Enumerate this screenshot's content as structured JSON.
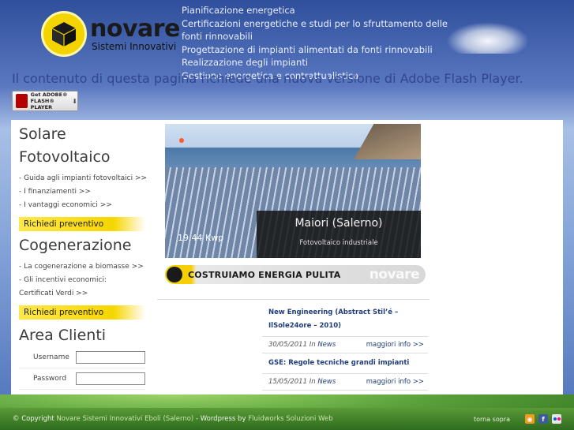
{
  "header": {
    "logo_name": "novare",
    "logo_sub": "Sistemi Innovativi",
    "services": [
      "Pianificazione energetica",
      "Certificazioni energetiche e studi per lo sfruttamento delle fonti rinnovabili",
      "Progettazione di impianti alimentati da fonti rinnovabili",
      "Realizzazione degli impianti",
      "Gestione energetica e contrattualistica"
    ],
    "flash_message": "Il contenuto di questa pagina richiede una nuova versione di Adobe Flash Player.",
    "flash_badge": {
      "line1": "Get ADOBE®",
      "line2": "FLASH® PLAYER"
    }
  },
  "sidebar": {
    "solare": {
      "title_line1": "Solare",
      "title_line2": "Fotovoltaico",
      "links": [
        "- Guida agli impianti fotovoltaici >>",
        "- I finanziamenti >>",
        "- I vantaggi economici >>"
      ],
      "button": "Richiedi preventivo"
    },
    "cogenerazione": {
      "title": "Cogenerazione",
      "links": [
        "- La cogenerazione a biomasse >>",
        "- Gli incentivi economici:",
        "Certificati Verdi >>"
      ],
      "button": "Richiedi preventivo"
    },
    "area_clienti": {
      "title": "Area Clienti",
      "username_label": "Username",
      "password_label": "Password"
    }
  },
  "slide": {
    "location": "Maiori (Salerno)",
    "type": "Fotovoltaico industriale",
    "power": "19.44 Kwp"
  },
  "banner": {
    "text": "COSTRUIAMO ENERGIA PULITA",
    "brand": "novare"
  },
  "news": [
    {
      "title": "New Engineering (Abstract Stil’é – IlSole24ore – 2010)",
      "date": "30/05/2011",
      "in": "In",
      "category": "News",
      "more": "maggiori info >>"
    },
    {
      "title": "GSE: Regole tecniche grandi impianti",
      "date": "15/05/2011",
      "in": "In",
      "category": "News",
      "more": "maggiori info >>"
    }
  ],
  "footer": {
    "copyright": "© Copyright",
    "company": "Novare Sistemi Innovativi Eboli (Salerno)",
    "wordpress": "- Wordpress by",
    "developer": "Fluidworks Soluzioni Web",
    "top_link": "torna sopra",
    "icons": [
      "rss-icon",
      "facebook-icon",
      "flickr-icon"
    ]
  },
  "colors": {
    "accent_yellow": "#f6d600",
    "news_blue": "#1f3d7a",
    "footer_green": "#2e6b1f"
  }
}
